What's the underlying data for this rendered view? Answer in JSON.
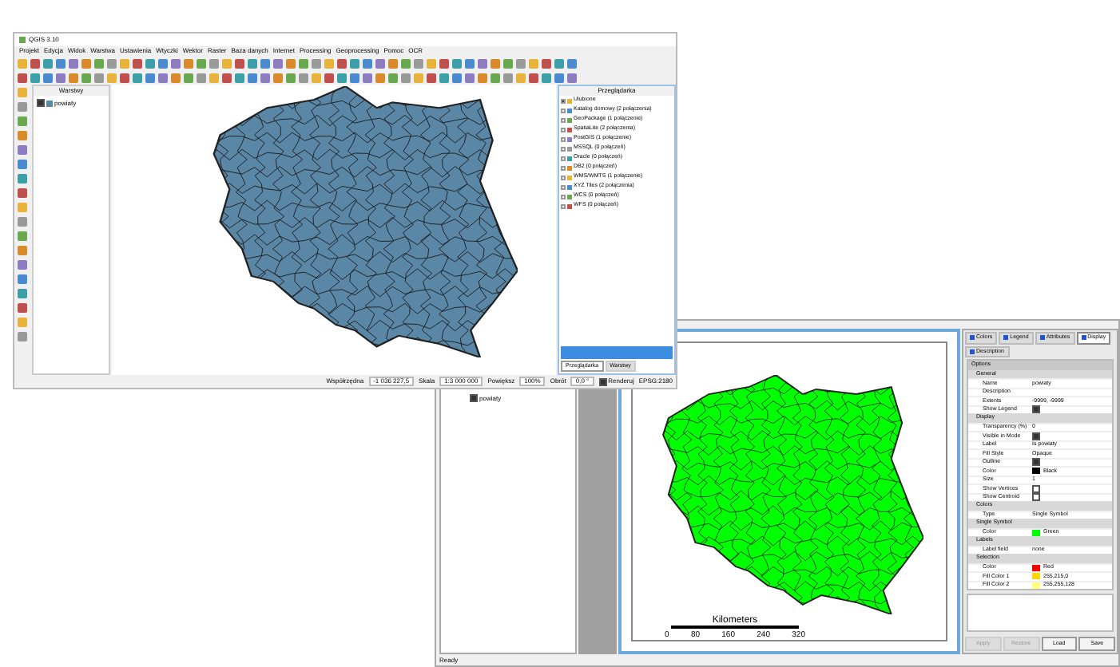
{
  "qgis": {
    "title": "QGIS 3.10",
    "menu": [
      "Projekt",
      "Edycja",
      "Widok",
      "Warstwa",
      "Ustawienia",
      "Wtyczki",
      "Wektor",
      "Raster",
      "Baza danych",
      "Internet",
      "Processing",
      "Geoprocessing",
      "Pomoc",
      "OCR"
    ],
    "layers_panel": {
      "title": "Warstwy",
      "layers": [
        {
          "name": "powiaty",
          "checked": true
        }
      ]
    },
    "browser_panel": {
      "title": "Przeglądarka",
      "items": [
        {
          "label": "Ulubione",
          "expanded": true
        },
        {
          "label": "Katalog domowy (2 połączenia)",
          "expanded": false
        },
        {
          "label": "GeoPackage (1 połączenie)",
          "expanded": false
        },
        {
          "label": "SpatiaLite (2 połączenia)",
          "expanded": false
        },
        {
          "label": "PostGIS (1 połączenie)",
          "expanded": false
        },
        {
          "label": "MSSQL (0 połączeń)",
          "expanded": false
        },
        {
          "label": "Oracle (0 połączeń)",
          "expanded": false
        },
        {
          "label": "DB2 (0 połączeń)",
          "expanded": false
        },
        {
          "label": "WMS/WMTS (1 połączenie)",
          "expanded": false
        },
        {
          "label": "XYZ Tiles (2 połączenia)",
          "expanded": false
        },
        {
          "label": "WCS (0 połączeń)",
          "expanded": false
        },
        {
          "label": "WFS (0 połączeń)",
          "expanded": false
        }
      ],
      "tabs": [
        {
          "label": "Przeglądarka",
          "selected": true
        },
        {
          "label": "Warstwy",
          "selected": false
        }
      ]
    },
    "status_bar": [
      {
        "label": "Współrzędna",
        "value": "-1 036 227,5"
      },
      {
        "label": "Skala",
        "value": "1:3 000 000"
      },
      {
        "label": "Powiększ",
        "value": "100%"
      },
      {
        "label": "Obrót",
        "value": "0,0 °"
      }
    ],
    "render": {
      "label": "Renderuj",
      "checked": true
    },
    "crs": "EPSG:2180"
  },
  "viewer": {
    "layers": [
      {
        "name": "powiaty",
        "checked": true
      }
    ],
    "scale_bar": {
      "title": "Kilometers",
      "ticks": [
        "0",
        "80",
        "160",
        "240",
        "320"
      ]
    },
    "properties": {
      "tabs": [
        {
          "label": "Colors",
          "selected": false
        },
        {
          "label": "Legend",
          "selected": false
        },
        {
          "label": "Attributes",
          "selected": false
        },
        {
          "label": "Display",
          "selected": true
        },
        {
          "label": "Description",
          "selected": false
        }
      ],
      "rows": [
        {
          "kind": "group",
          "label": "Options"
        },
        {
          "kind": "section",
          "label": "General"
        },
        {
          "kind": "text",
          "label": "Name",
          "value": "powiaty"
        },
        {
          "kind": "text",
          "label": "Description"
        },
        {
          "kind": "text",
          "label": "Extents",
          "value": "-9999, -9999"
        },
        {
          "kind": "check",
          "label": "Show Legend",
          "checked": true
        },
        {
          "kind": "section",
          "label": "Display"
        },
        {
          "kind": "text",
          "label": "Transparency (%)",
          "value": "0"
        },
        {
          "kind": "check",
          "label": "Visible in Mode",
          "checked": true
        },
        {
          "kind": "text",
          "label": "Label",
          "value": "Is powiaty"
        },
        {
          "kind": "text",
          "label": "Fill Style",
          "value": "Opaque"
        },
        {
          "kind": "check",
          "label": "Outline",
          "checked": true
        },
        {
          "kind": "color",
          "label": "Color",
          "color": "#000000",
          "value": "Black"
        },
        {
          "kind": "text",
          "label": "Size",
          "value": "1"
        },
        {
          "kind": "check",
          "label": "Show Vertices",
          "checked": false
        },
        {
          "kind": "check",
          "label": "Show Centroid",
          "checked": false
        },
        {
          "kind": "section",
          "label": "Colors"
        },
        {
          "kind": "text",
          "label": "Type",
          "value": "Single Symbol"
        },
        {
          "kind": "section",
          "label": "Single Symbol"
        },
        {
          "kind": "color",
          "label": "Color",
          "color": "#00ff00",
          "value": "Green"
        },
        {
          "kind": "section",
          "label": "Labels"
        },
        {
          "kind": "text",
          "label": "Label field",
          "value": "none"
        },
        {
          "kind": "section",
          "label": "Selection"
        },
        {
          "kind": "color",
          "label": "Color",
          "color": "#ff0000",
          "value": "Red"
        },
        {
          "kind": "color",
          "label": "Fill Color 1",
          "color": "#ffd700",
          "value": "255,215,0"
        },
        {
          "kind": "color",
          "label": "Fill Color 2",
          "color": "#ffff80",
          "value": "255,255,128"
        }
      ],
      "buttons": [
        {
          "label": "Apply",
          "disabled": true
        },
        {
          "label": "Restore",
          "disabled": true
        },
        {
          "label": "Load",
          "disabled": false
        },
        {
          "label": "Save",
          "disabled": false
        }
      ]
    },
    "status": "Ready"
  }
}
